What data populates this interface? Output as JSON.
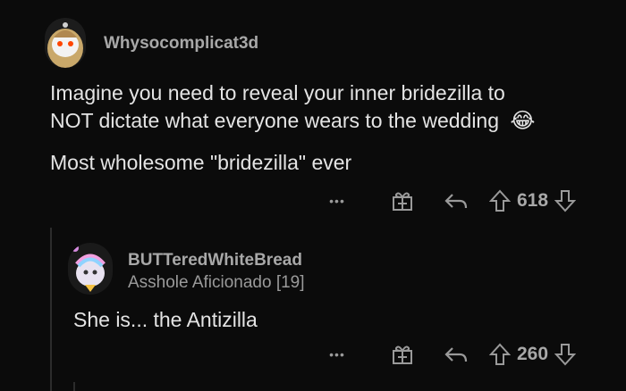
{
  "comment1": {
    "username": "Whysocomplicat3d",
    "line1": "Imagine you need to reveal your inner bridezilla to",
    "line2": "NOT dictate what everyone wears to the wedding",
    "line3": "Most wholesome \"bridezilla\" ever",
    "emoji": "😂",
    "score": "618",
    "more": "•••"
  },
  "comment2": {
    "username": "BUTTeredWhiteBread",
    "flair": "Asshole Aficionado [19]",
    "text": "She is... the Antizilla",
    "score": "260",
    "more": "•••"
  },
  "icons": [
    "award-icon",
    "reply-icon",
    "upvote-icon",
    "downvote-icon",
    "more-icon"
  ]
}
